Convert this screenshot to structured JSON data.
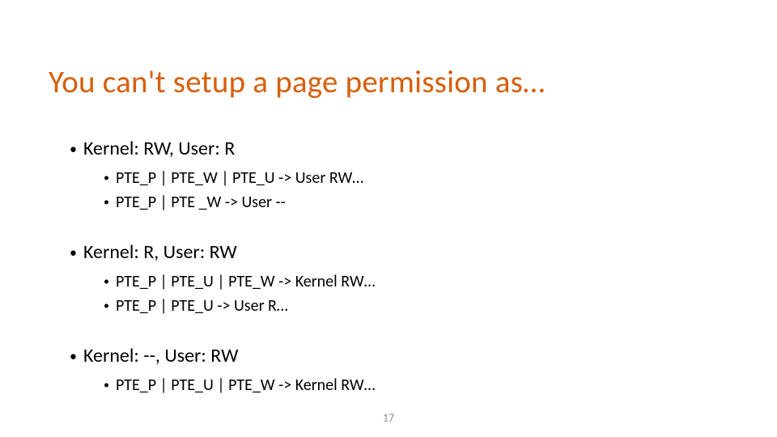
{
  "title": "You can't setup a page permission as…",
  "sections": [
    {
      "heading": "Kernel: RW, User: R",
      "items": [
        "PTE_P | PTE_W | PTE_U -> User RW…",
        "PTE_P | PTE _W  -> User --"
      ]
    },
    {
      "heading": "Kernel: R, User: RW",
      "items": [
        "PTE_P | PTE_U | PTE_W -> Kernel RW…",
        "PTE_P | PTE_U       -> User R…"
      ]
    },
    {
      "heading": "Kernel: --, User: RW",
      "items": [
        "PTE_P | PTE_U | PTE_W -> Kernel RW…"
      ]
    }
  ],
  "page_number": "17"
}
